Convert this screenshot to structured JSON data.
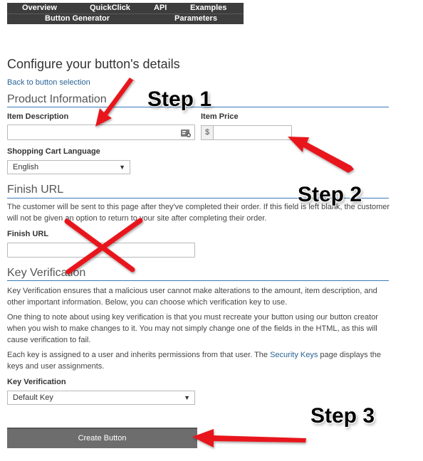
{
  "nav": {
    "row1": [
      "Overview",
      "QuickClick",
      "API",
      "Examples"
    ],
    "row2": [
      "Button Generator",
      "Parameters"
    ]
  },
  "page": {
    "title": "Configure your button's details",
    "back_link": "Back to button selection"
  },
  "product_info": {
    "section_title": "Product Information",
    "item_description_label": "Item Description",
    "item_description_value": "",
    "item_price_label": "Item Price",
    "currency_symbol": "$",
    "item_price_value": "",
    "language_label": "Shopping Cart Language",
    "language_value": "English"
  },
  "finish_url": {
    "section_title": "Finish URL",
    "description": "The customer will be sent to this page after they've completed their order. If this field is left blank, the customer will not be given an option to return to your site after completing their order.",
    "field_label": "Finish URL",
    "field_value": ""
  },
  "key_verification": {
    "section_title": "Key Verification",
    "para1": "Key Verification ensures that a malicious user cannot make alterations to the amount, item description, and other important information. Below, you can choose which verification key to use.",
    "para2": "One thing to note about using key verification is that you must recreate your button using our button creator when you wish to make changes to it. You may not simply change one of the fields in the HTML, as this will cause verification to fail.",
    "para3_before": "Each key is assigned to a user and inherits permissions from that user. The ",
    "para3_link": "Security Keys",
    "para3_after": " page displays the keys and user assignments.",
    "field_label": "Key Verification",
    "field_value": "Default Key"
  },
  "actions": {
    "create_button": "Create Button"
  },
  "annotations": {
    "step1": "Step 1",
    "step2": "Step 2",
    "step3": "Step 3",
    "arrow_color": "#e8141b",
    "x_mark_color": "#e8141b"
  },
  "icons": {
    "field_helper": "contact-card-icon",
    "dropdown": "chevron-down-icon"
  }
}
